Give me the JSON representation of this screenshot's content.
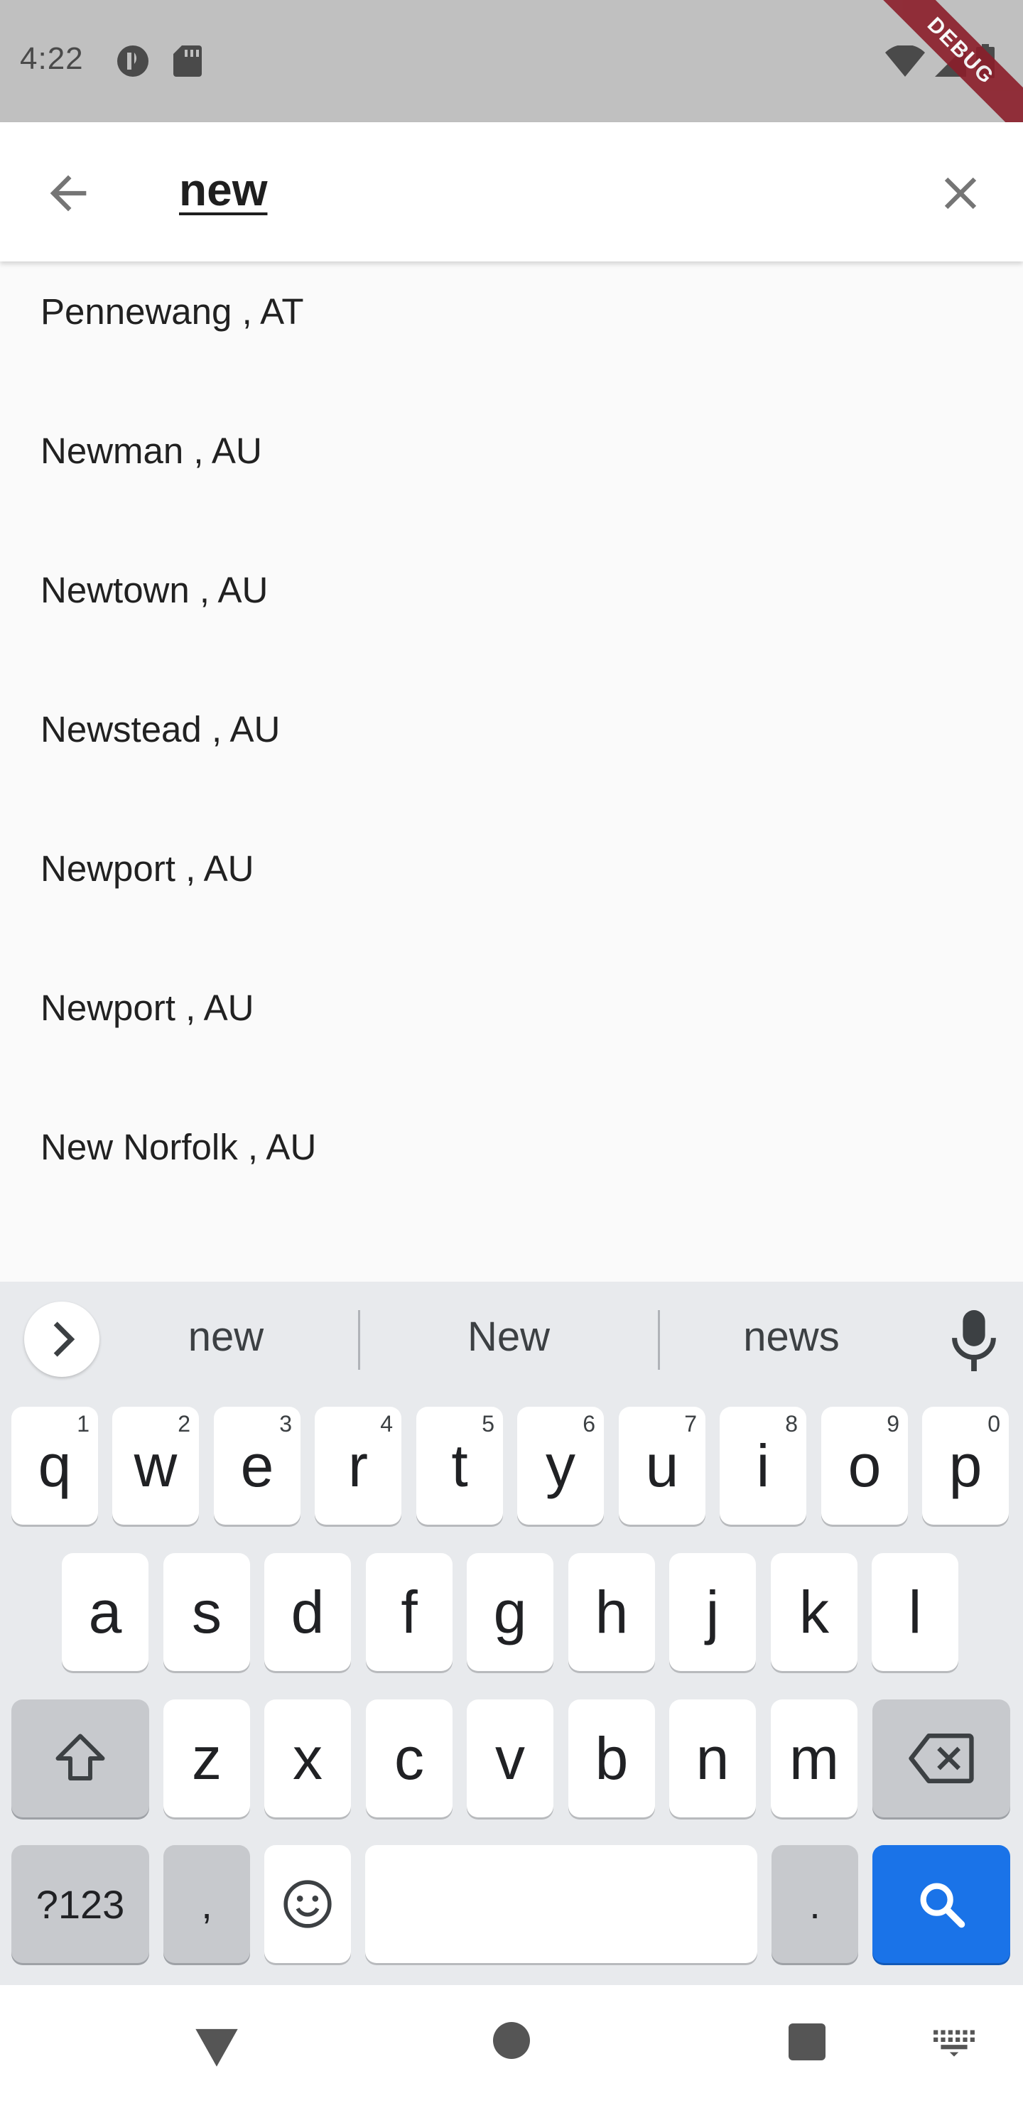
{
  "status_bar": {
    "time": "4:22",
    "debug_label": "DEBUG"
  },
  "search": {
    "query": "new"
  },
  "results": [
    {
      "label": "Pennewang , AT"
    },
    {
      "label": "Newman , AU"
    },
    {
      "label": "Newtown , AU"
    },
    {
      "label": "Newstead , AU"
    },
    {
      "label": "Newport , AU"
    },
    {
      "label": "Newport , AU"
    },
    {
      "label": "New Norfolk , AU"
    }
  ],
  "keyboard": {
    "suggestions": [
      "new",
      "New",
      "news"
    ],
    "row1": [
      {
        "key": "q",
        "hint": "1"
      },
      {
        "key": "w",
        "hint": "2"
      },
      {
        "key": "e",
        "hint": "3"
      },
      {
        "key": "r",
        "hint": "4"
      },
      {
        "key": "t",
        "hint": "5"
      },
      {
        "key": "y",
        "hint": "6"
      },
      {
        "key": "u",
        "hint": "7"
      },
      {
        "key": "i",
        "hint": "8"
      },
      {
        "key": "o",
        "hint": "9"
      },
      {
        "key": "p",
        "hint": "0"
      }
    ],
    "row2": [
      "a",
      "s",
      "d",
      "f",
      "g",
      "h",
      "j",
      "k",
      "l"
    ],
    "row3": [
      "z",
      "x",
      "c",
      "v",
      "b",
      "n",
      "m"
    ],
    "symbols_label": "?123",
    "comma_label": ",",
    "period_label": ".",
    "accent_color": "#1a73e8"
  }
}
